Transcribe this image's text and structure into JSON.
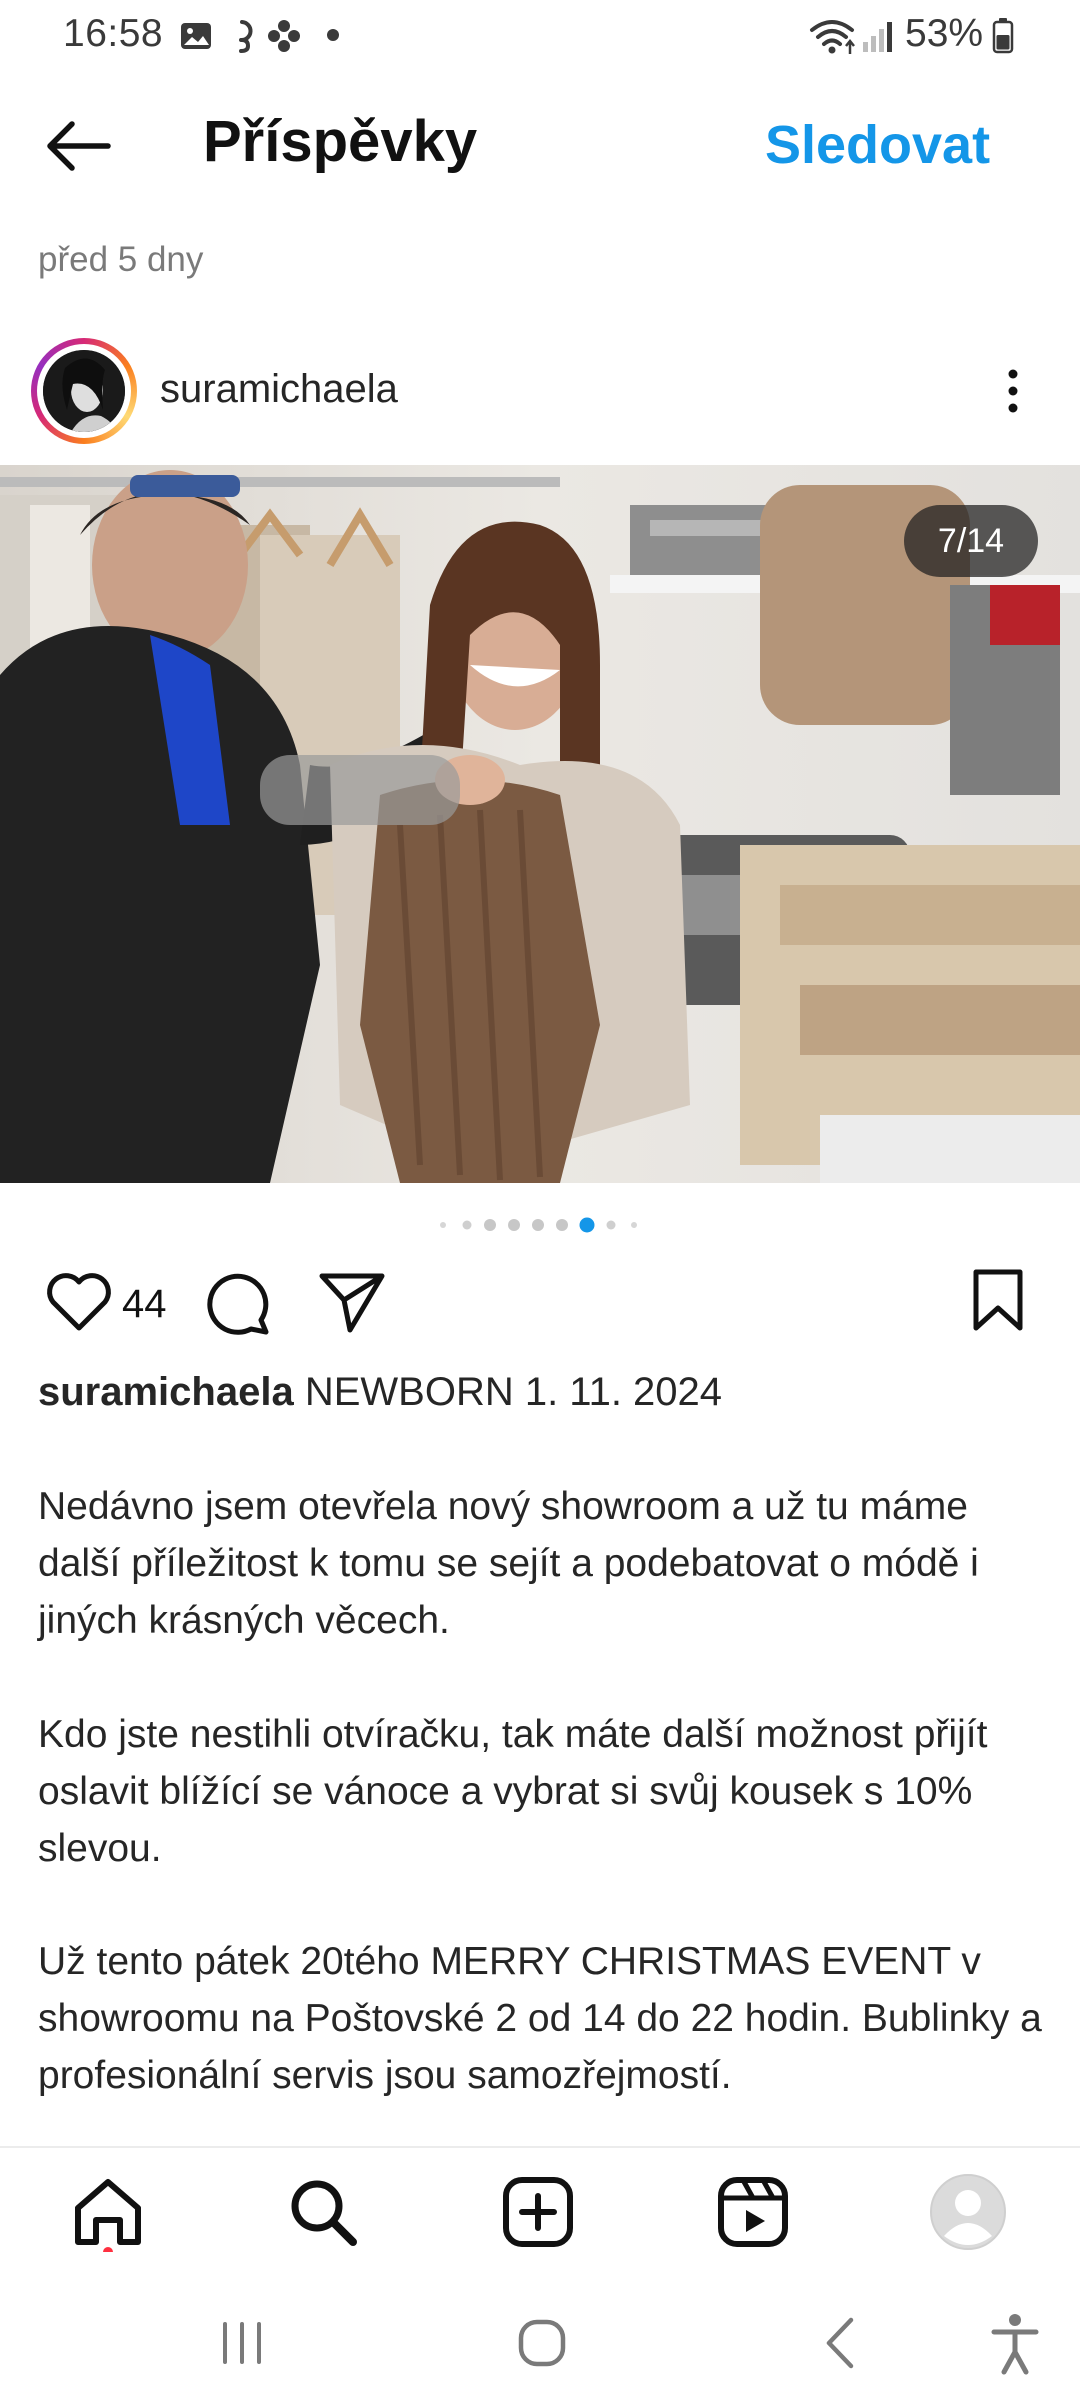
{
  "status_bar": {
    "time": "16:58",
    "battery": "53%",
    "icons": [
      "gallery-icon",
      "threads-icon",
      "flower-icon",
      "dot-icon",
      "wifi-icon",
      "signal-icon",
      "battery-icon"
    ]
  },
  "header": {
    "title": "Příspěvky",
    "follow_label": "Sledovat",
    "back_icon": "arrow-left-icon"
  },
  "post": {
    "age": "před 5 dny",
    "username": "suramichaela",
    "carousel": {
      "counter": "7/14",
      "current_index": 7,
      "total": 14
    },
    "likes": "44",
    "caption": {
      "username": "suramichaela",
      "headline": "NEWBORN 1. 11. 2024",
      "paragraphs": [
        "Nedávno jsem otevřela nový showroom a už tu máme další příležitost k tomu se sejít a podebatovat o módě i jiných krásných věcech.",
        "Kdo jste nestihli otvíračku, tak máte další možnost přijít oslavit blížící se vánoce a vybrat si svůj kousek s 10% slevou.",
        "Už tento pátek 20tého MERRY CHRISTMAS EVENT v showroomu na Poštovské 2 od 14 do 22 hodin. Bublinky a profesionální servis jsou samozřejmostí."
      ]
    }
  },
  "bottom_nav": [
    "home-icon",
    "search-icon",
    "create-icon",
    "reels-icon",
    "profile-icon"
  ],
  "system_nav": [
    "recents-icon",
    "home-circle-icon",
    "back-icon",
    "accessibility-icon"
  ],
  "colors": {
    "accent": "#1496e8",
    "text": "#262626",
    "muted": "#7a7a7a",
    "notification_dot": "#ff3040"
  }
}
